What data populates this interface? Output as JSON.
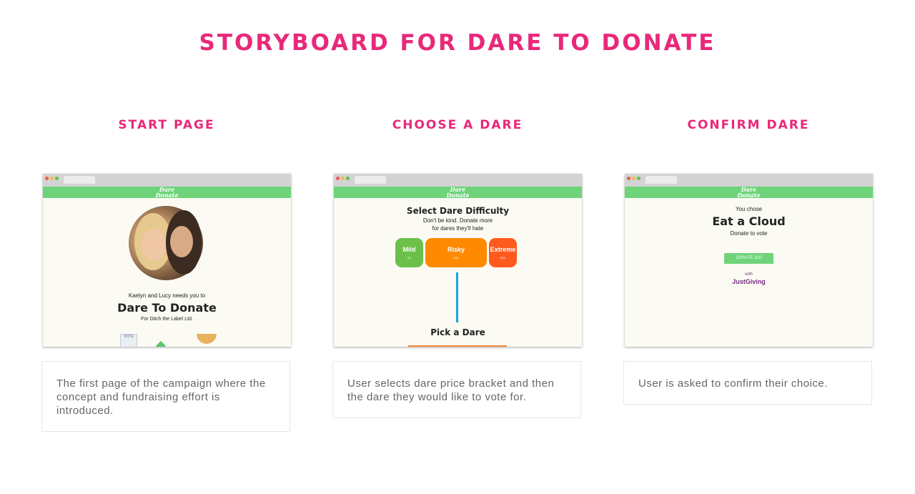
{
  "page_title": "STORYBOARD FOR DARE TO DONATE",
  "columns": [
    {
      "heading": "START PAGE",
      "description": "The first page of the campaign where the concept and fundraising effort is introduced.",
      "screen": {
        "logo": "Dare to Donate",
        "invite": "Kaelyn and Lucy needs you to",
        "campaign_title": "Dare To Donate",
        "charity": "For Ditch the Label Ltd.",
        "vote_badge": "VOTE"
      }
    },
    {
      "heading": "CHOOSE A DARE",
      "description": "User selects dare price bracket and then the dare they would like to vote for.",
      "screen": {
        "logo": "Dare to Donate",
        "title": "Select Dare Difficulty",
        "subtitle_line1": "Don't be kind. Donate more",
        "subtitle_line2": "for dares they'll hate",
        "options": [
          {
            "label": "Mild",
            "price": "£5",
            "color": "#6cc04a"
          },
          {
            "label": "Risky",
            "price": "£20",
            "color": "#ff8a00"
          },
          {
            "label": "Extreme",
            "price": "£50",
            "color": "#ff5a1e"
          }
        ],
        "pick_label": "Pick a Dare",
        "connector_color": "#1aa3e8"
      }
    },
    {
      "heading": "CONFIRM DARE",
      "description": "User is asked to confirm their choice.",
      "screen": {
        "logo": "Dare to Donate",
        "you_chose": "You chose",
        "dare_name": "Eat a Cloud",
        "donate_to_vote": "Donate to vote",
        "donate_button": "DONATE £20",
        "with": "with",
        "provider": "JustGiving"
      }
    }
  ],
  "colors": {
    "accent": "#e8297a",
    "header_green": "#6fd37a",
    "description_text": "#666666"
  }
}
